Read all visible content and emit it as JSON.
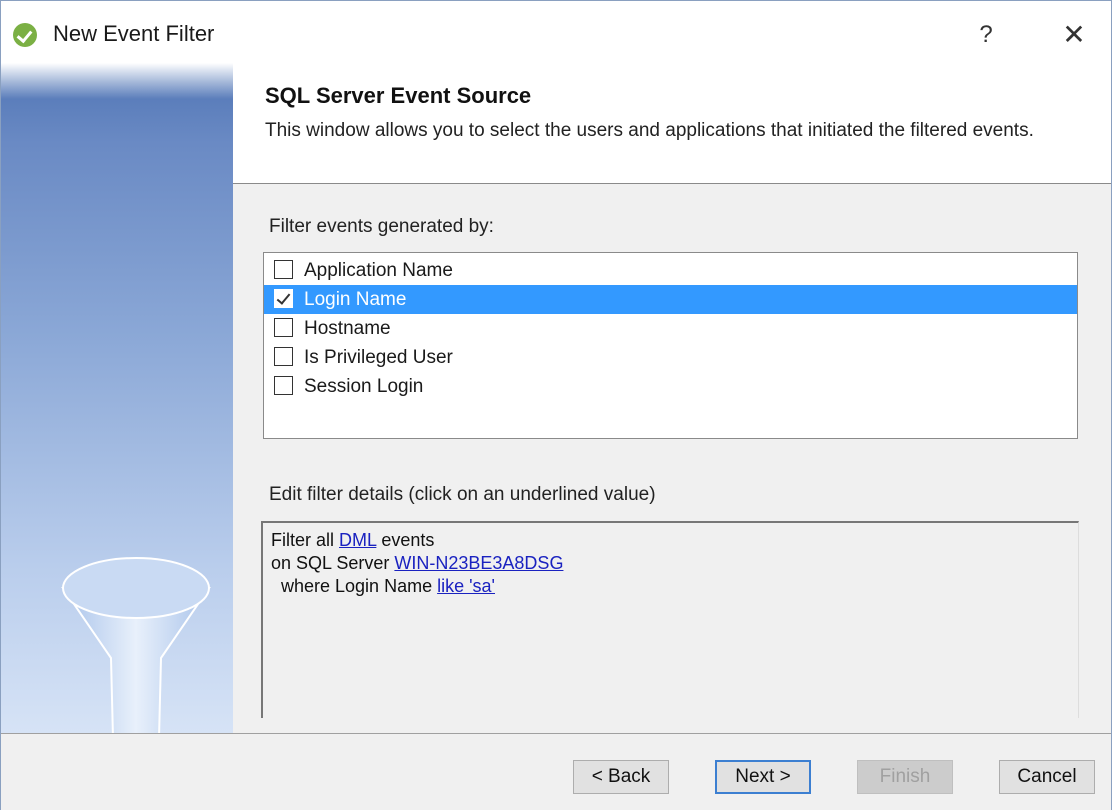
{
  "window": {
    "title": "New Event Filter",
    "help_label": "?",
    "close_label": "✕"
  },
  "header": {
    "title": "SQL Server Event Source",
    "description": "This window allows you to select the users and applications that initiated the filtered events."
  },
  "filter_list": {
    "label": "Filter events generated by:",
    "items": [
      {
        "label": "Application Name",
        "checked": false,
        "selected": false
      },
      {
        "label": "Login Name",
        "checked": true,
        "selected": true
      },
      {
        "label": "Hostname",
        "checked": false,
        "selected": false
      },
      {
        "label": "Is Privileged User",
        "checked": false,
        "selected": false
      },
      {
        "label": "Session Login",
        "checked": false,
        "selected": false
      }
    ]
  },
  "details": {
    "label": "Edit filter details (click on an underlined value)",
    "line1_prefix": "Filter all ",
    "line1_link": "DML",
    "line1_suffix": " events",
    "line2_prefix": "on SQL Server ",
    "line2_link": "WIN-N23BE3A8DSG",
    "line3_prefix": "  where Login Name ",
    "line3_link": "like 'sa'"
  },
  "buttons": {
    "back": "< Back",
    "next": "Next >",
    "finish": "Finish",
    "cancel": "Cancel"
  },
  "colors": {
    "selection": "#3399ff",
    "link": "#1a22c0",
    "sidebar_top": "#4f74b4",
    "sidebar_bottom": "#d6e3f6",
    "app_icon": "#7bb044"
  }
}
